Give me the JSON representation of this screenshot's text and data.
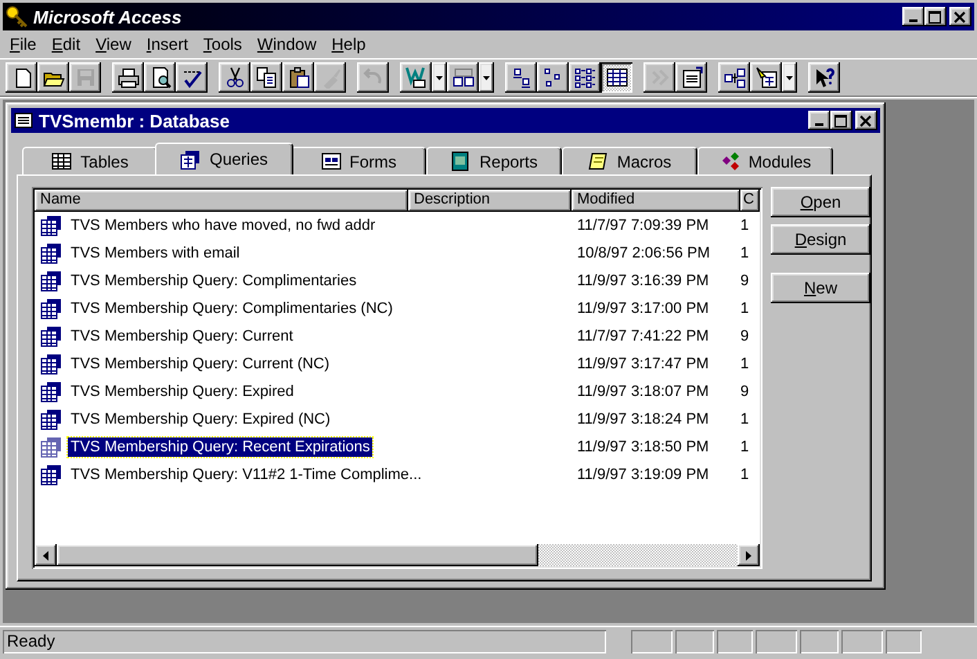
{
  "app_window": {
    "title": "Microsoft Access"
  },
  "menu": [
    {
      "label": "File"
    },
    {
      "label": "Edit"
    },
    {
      "label": "View"
    },
    {
      "label": "Insert"
    },
    {
      "label": "Tools"
    },
    {
      "label": "Window"
    },
    {
      "label": "Help"
    }
  ],
  "toolbar": [
    {
      "disabled": false,
      "pressed": false
    },
    {
      "disabled": false,
      "pressed": false
    },
    {
      "disabled": true,
      "pressed": false
    },
    {
      "disabled": false,
      "pressed": false
    },
    {
      "disabled": false,
      "pressed": false
    },
    {
      "disabled": false,
      "pressed": false
    },
    {
      "disabled": false,
      "pressed": false
    },
    {
      "disabled": false,
      "pressed": false
    },
    {
      "disabled": false,
      "pressed": false
    },
    {
      "disabled": true,
      "pressed": false
    },
    {
      "disabled": true,
      "pressed": false
    },
    {
      "disabled": false,
      "pressed": false
    },
    {
      "disabled": false,
      "pressed": false
    },
    {
      "disabled": false,
      "pressed": false
    },
    {
      "disabled": false,
      "pressed": false
    },
    {
      "disabled": false,
      "pressed": false
    },
    {
      "disabled": false,
      "pressed": true
    },
    {
      "disabled": true,
      "pressed": false
    },
    {
      "disabled": false,
      "pressed": false
    },
    {
      "disabled": false,
      "pressed": false
    },
    {
      "disabled": false,
      "pressed": false
    },
    {
      "disabled": false,
      "pressed": false
    }
  ],
  "database_window": {
    "title": "TVSmembr : Database",
    "tabs": [
      {
        "label": "Tables",
        "selected": false
      },
      {
        "label": "Queries",
        "selected": true
      },
      {
        "label": "Forms",
        "selected": false
      },
      {
        "label": "Reports",
        "selected": false
      },
      {
        "label": "Macros",
        "selected": false
      },
      {
        "label": "Modules",
        "selected": false
      }
    ],
    "columns": [
      "Name",
      "Description",
      "Modified",
      "C"
    ],
    "rows": [
      {
        "name": "TVS Members who have moved, no fwd addr",
        "modified": "11/7/97 7:09:39 PM",
        "column_4": "1",
        "selected": false
      },
      {
        "name": "TVS Members with email",
        "modified": "10/8/97 2:06:56 PM",
        "column_4": "1",
        "selected": false
      },
      {
        "name": "TVS Membership Query: Complimentaries",
        "modified": "11/9/97 3:16:39 PM",
        "column_4": "9",
        "selected": false
      },
      {
        "name": "TVS Membership Query: Complimentaries (NC)",
        "modified": "11/9/97 3:17:00 PM",
        "column_4": "1",
        "selected": false
      },
      {
        "name": "TVS Membership Query: Current",
        "modified": "11/7/97 7:41:22 PM",
        "column_4": "9",
        "selected": false
      },
      {
        "name": "TVS Membership Query: Current (NC)",
        "modified": "11/9/97 3:17:47 PM",
        "column_4": "1",
        "selected": false
      },
      {
        "name": "TVS Membership Query: Expired",
        "modified": "11/9/97 3:18:07 PM",
        "column_4": "9",
        "selected": false
      },
      {
        "name": "TVS Membership Query: Expired (NC)",
        "modified": "11/9/97 3:18:24 PM",
        "column_4": "1",
        "selected": false
      },
      {
        "name": "TVS Membership Query: Recent Expirations",
        "modified": "11/9/97 3:18:50 PM",
        "column_4": "1",
        "selected": true
      },
      {
        "name": "TVS Membership Query: V11#2 1-Time Complime...",
        "modified": "11/9/97 3:19:09 PM",
        "column_4": "1",
        "selected": false
      }
    ],
    "buttons": [
      {
        "label": "Open"
      },
      {
        "label": "Design"
      },
      {
        "label": "New"
      }
    ]
  },
  "status_bar": {
    "text": "Ready"
  }
}
